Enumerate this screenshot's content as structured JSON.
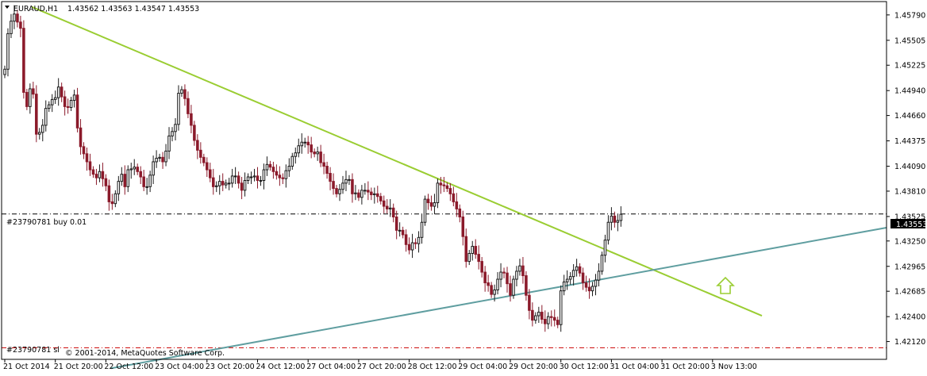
{
  "header": {
    "symbol_text": "EURAUD,H1",
    "ohlc_text": "1.43562 1.43563 1.43547 1.43553"
  },
  "order_label": "#23790781 buy 0.01",
  "bottom_label": "#23790781 sl",
  "copyright": "© 2001-2014, MetaQuotes Software Corp.",
  "current_price_label": "1.43553",
  "colors": {
    "bull_candle": "#1a1a1a",
    "bear_candle": "#8b1a2b",
    "downtrend_line": "#9acd32",
    "uptrend_line": "#5f9ea0",
    "order_line": "#000000",
    "sl_line": "#cc0000",
    "arrow": "#9acd32",
    "axis_text": "#000000"
  },
  "chart_data": {
    "type": "candlestick",
    "timeframe": "H1",
    "symbol": "EURAUD",
    "ylim": [
      1.4192,
      1.4594
    ],
    "y_ticks": [
      "1.45790",
      "1.45505",
      "1.45225",
      "1.44940",
      "1.44660",
      "1.44375",
      "1.44090",
      "1.43810",
      "1.43525",
      "1.43250",
      "1.42965",
      "1.42685",
      "1.42400",
      "1.42120"
    ],
    "x_ticks": [
      "21 Oct 2014",
      "21 Oct 20:00",
      "22 Oct 12:00",
      "23 Oct 04:00",
      "23 Oct 20:00",
      "24 Oct 12:00",
      "27 Oct 04:00",
      "27 Oct 20:00",
      "28 Oct 12:00",
      "29 Oct 04:00",
      "29 Oct 20:00",
      "30 Oct 12:00",
      "31 Oct 04:00",
      "31 Oct 20:00",
      "3 Nov 13:00"
    ],
    "candle_spacing_ticks_per_bar": 0.0625,
    "closes": [
      1.4518,
      1.4558,
      1.4572,
      1.458,
      1.4571,
      1.4564,
      1.4492,
      1.4476,
      1.4496,
      1.449,
      1.4445,
      1.4447,
      1.4455,
      1.4474,
      1.4478,
      1.4484,
      1.4486,
      1.4498,
      1.4487,
      1.4476,
      1.4475,
      1.4483,
      1.4489,
      1.4452,
      1.4431,
      1.4423,
      1.4414,
      1.4405,
      1.44,
      1.4396,
      1.4403,
      1.4395,
      1.4387,
      1.4369,
      1.4367,
      1.4378,
      1.4392,
      1.44,
      1.4386,
      1.4405,
      1.4406,
      1.4408,
      1.4403,
      1.4397,
      1.4386,
      1.4386,
      1.4399,
      1.4414,
      1.4418,
      1.4419,
      1.4414,
      1.4426,
      1.4443,
      1.4448,
      1.4456,
      1.4491,
      1.4495,
      1.4485,
      1.4468,
      1.4455,
      1.4438,
      1.4427,
      1.4419,
      1.4413,
      1.4405,
      1.4396,
      1.4386,
      1.4387,
      1.4392,
      1.4388,
      1.439,
      1.439,
      1.4398,
      1.4398,
      1.439,
      1.4382,
      1.4393,
      1.4397,
      1.4397,
      1.4398,
      1.4393,
      1.4393,
      1.4405,
      1.4411,
      1.4408,
      1.4403,
      1.4399,
      1.4396,
      1.4395,
      1.4404,
      1.4409,
      1.442,
      1.4424,
      1.4432,
      1.4436,
      1.4436,
      1.4433,
      1.4425,
      1.4423,
      1.4425,
      1.4413,
      1.4409,
      1.4401,
      1.4392,
      1.4384,
      1.4378,
      1.4383,
      1.439,
      1.4394,
      1.4394,
      1.4378,
      1.4379,
      1.4374,
      1.4382,
      1.4382,
      1.438,
      1.4377,
      1.4378,
      1.4375,
      1.437,
      1.4364,
      1.4361,
      1.4362,
      1.4352,
      1.4337,
      1.4337,
      1.4332,
      1.4321,
      1.4315,
      1.4323,
      1.4322,
      1.4329,
      1.4346,
      1.4372,
      1.4368,
      1.4364,
      1.4368,
      1.439,
      1.4388,
      1.4387,
      1.4384,
      1.4378,
      1.4369,
      1.4361,
      1.4352,
      1.433,
      1.4302,
      1.4311,
      1.4319,
      1.431,
      1.4302,
      1.429,
      1.4278,
      1.4275,
      1.4265,
      1.427,
      1.4282,
      1.429,
      1.4289,
      1.4277,
      1.4264,
      1.4282,
      1.4291,
      1.4297,
      1.4286,
      1.4264,
      1.4247,
      1.4236,
      1.4241,
      1.4245,
      1.4237,
      1.4232,
      1.424,
      1.4239,
      1.4236,
      1.4231,
      1.4269,
      1.4279,
      1.4282,
      1.4285,
      1.4292,
      1.4296,
      1.4289,
      1.4278,
      1.4273,
      1.4269,
      1.4274,
      1.4281,
      1.4291,
      1.4309,
      1.4326,
      1.4346,
      1.4353,
      1.4346,
      1.4348,
      1.4355
    ]
  }
}
